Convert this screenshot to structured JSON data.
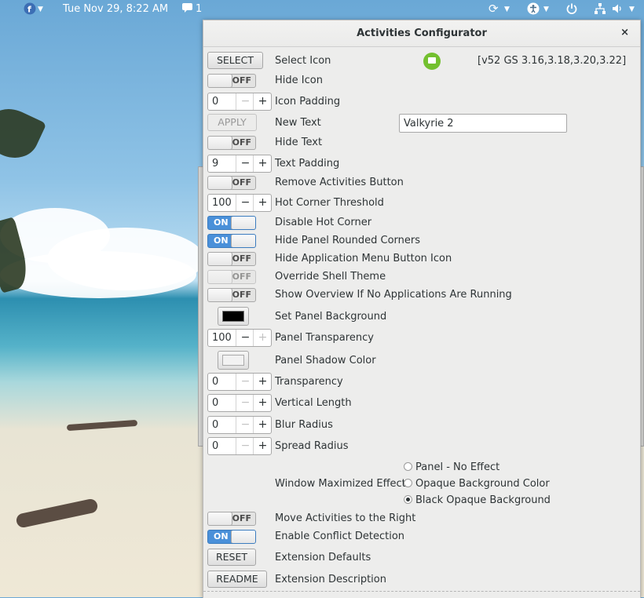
{
  "topbar": {
    "clock": "Tue Nov 29,  8:22 AM",
    "notifications_count": "1",
    "icons": [
      "fedora-logo-icon",
      "chat-icon",
      "refresh-icon",
      "accessibility-icon",
      "power-icon",
      "network-icon",
      "volume-icon"
    ]
  },
  "dialog": {
    "title": "Activities Configurator",
    "close": "×",
    "version": "[v52 GS 3.16,3.18,3.20,3.22]",
    "rows": {
      "select_icon": {
        "button": "SELECT",
        "label": "Select Icon"
      },
      "hide_icon": {
        "state": "OFF",
        "label": "Hide Icon"
      },
      "icon_padding": {
        "value": "0",
        "label": "Icon Padding"
      },
      "new_text": {
        "button": "APPLY",
        "label": "New Text",
        "value": "Valkyrie 2"
      },
      "hide_text": {
        "state": "OFF",
        "label": "Hide Text"
      },
      "text_padding": {
        "value": "9",
        "label": "Text Padding"
      },
      "remove_activities": {
        "state": "OFF",
        "label": "Remove Activities Button"
      },
      "hot_corner_threshold": {
        "value": "100",
        "label": "Hot Corner Threshold"
      },
      "disable_hot_corner": {
        "state": "ON",
        "label": "Disable Hot Corner"
      },
      "hide_rounded": {
        "state": "ON",
        "label": "Hide Panel Rounded Corners"
      },
      "hide_app_menu_icon": {
        "state": "OFF",
        "label": "Hide Application Menu Button Icon"
      },
      "override_theme": {
        "state": "OFF",
        "label": "Override Shell Theme"
      },
      "show_overview": {
        "state": "OFF",
        "label": "Show Overview If No Applications Are Running"
      },
      "panel_background": {
        "label": "Set Panel Background",
        "color": "#000000"
      },
      "panel_transparency": {
        "value": "100",
        "label": "Panel Transparency"
      },
      "shadow_color": {
        "label": "Panel Shadow Color",
        "color": "#eeeeee"
      },
      "transparency": {
        "value": "0",
        "label": "Transparency"
      },
      "vertical_length": {
        "value": "0",
        "label": "Vertical Length"
      },
      "blur_radius": {
        "value": "0",
        "label": "Blur Radius"
      },
      "spread_radius": {
        "value": "0",
        "label": "Spread Radius"
      },
      "window_maximized": {
        "label": "Window Maximized Effect",
        "options": [
          "Panel - No Effect",
          "Opaque Background Color",
          "Black Opaque Background"
        ],
        "selected": "Black Opaque Background"
      },
      "move_right": {
        "state": "OFF",
        "label": "Move Activities to the Right"
      },
      "conflict_detection": {
        "state": "ON",
        "label": "Enable Conflict Detection"
      },
      "reset": {
        "button": "RESET",
        "label": "Extension Defaults"
      },
      "readme": {
        "button": "README",
        "label": "Extension Description"
      }
    },
    "spin_minus": "−",
    "spin_plus": "+"
  },
  "colors": {
    "accent": "#4a90d9",
    "icon_green": "#73c02f"
  }
}
